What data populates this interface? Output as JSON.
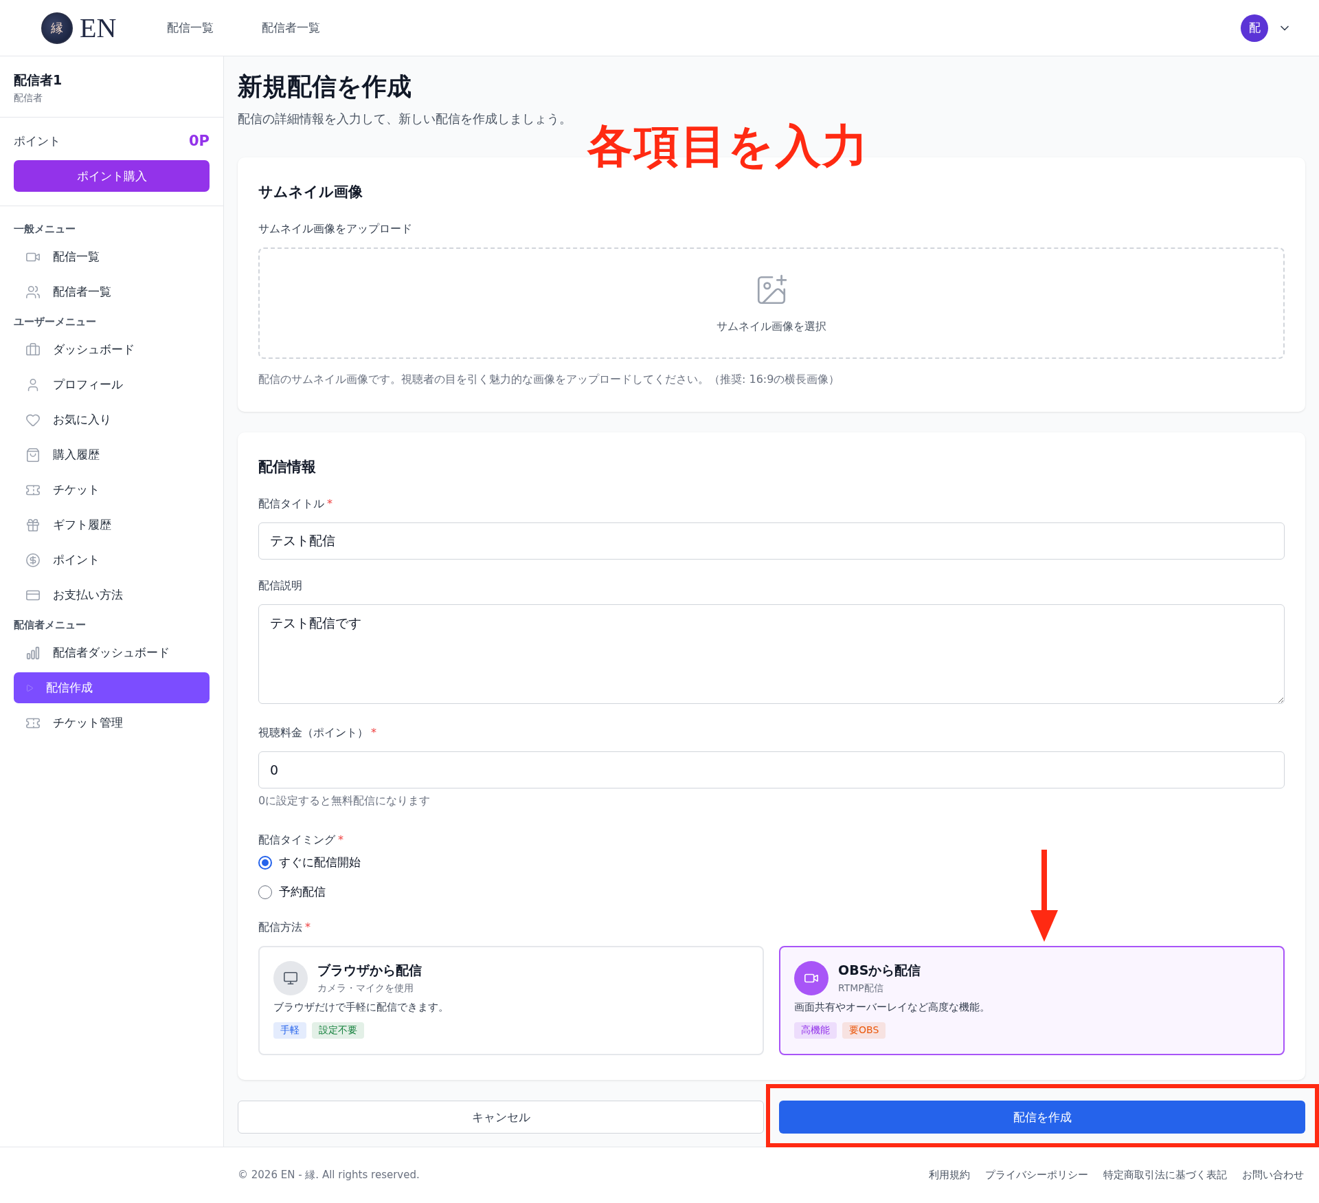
{
  "header": {
    "logo_mark": "縁",
    "logo_text": "EN",
    "nav": [
      "配信一覧",
      "配信者一覧"
    ],
    "avatar": "配"
  },
  "sidebar": {
    "user_name": "配信者1",
    "user_role": "配信者",
    "points_label": "ポイント",
    "points_value": "0P",
    "buy_button": "ポイント購入",
    "sections": [
      {
        "title": "一般メニュー",
        "items": [
          {
            "label": "配信一覧",
            "selected": false
          },
          {
            "label": "配信者一覧",
            "selected": false
          }
        ]
      },
      {
        "title": "ユーザーメニュー",
        "items": [
          {
            "label": "ダッシュボード",
            "selected": false
          },
          {
            "label": "プロフィール",
            "selected": false
          },
          {
            "label": "お気に入り",
            "selected": false
          },
          {
            "label": "購入履歴",
            "selected": false
          },
          {
            "label": "チケット",
            "selected": false
          },
          {
            "label": "ギフト履歴",
            "selected": false
          },
          {
            "label": "ポイント",
            "selected": false
          },
          {
            "label": "お支払い方法",
            "selected": false
          }
        ]
      },
      {
        "title": "配信者メニュー",
        "items": [
          {
            "label": "配信者ダッシュボード",
            "selected": false
          },
          {
            "label": "配信作成",
            "selected": true
          },
          {
            "label": "チケット管理",
            "selected": false
          }
        ]
      }
    ]
  },
  "page": {
    "title": "新規配信を作成",
    "subtitle": "配信の詳細情報を入力して、新しい配信を作成しましょう。"
  },
  "thumbnail_card": {
    "title": "サムネイル画像",
    "label": "サムネイル画像をアップロード",
    "drop_text": "サムネイル画像を選択",
    "help": "配信のサムネイル画像です。視聴者の目を引く魅力的な画像をアップロードしてください。（推奨: 16:9の横長画像）"
  },
  "info_card": {
    "title": "配信情報",
    "title_field": {
      "label": "配信タイトル",
      "required_mark": "*",
      "value": "テスト配信"
    },
    "description_field": {
      "label": "配信説明",
      "value": "テスト配信です"
    },
    "price_field": {
      "label": "視聴料金（ポイント）",
      "required_mark": "*",
      "value": "0",
      "help": "0に設定すると無料配信になります"
    },
    "timing": {
      "label": "配信タイミング",
      "required_mark": "*",
      "options": [
        {
          "label": "すぐに配信開始",
          "selected": true
        },
        {
          "label": "予約配信",
          "selected": false
        }
      ]
    },
    "method": {
      "label": "配信方法",
      "required_mark": "*",
      "options": [
        {
          "title": "ブラウザから配信",
          "subtitle": "カメラ・マイクを使用",
          "description": "ブラウザだけで手軽に配信できます。",
          "selected": false,
          "tags": [
            {
              "label": "手軽",
              "color": "#2563eb"
            },
            {
              "label": "設定不要",
              "color": "#15803d"
            }
          ]
        },
        {
          "title": "OBSから配信",
          "subtitle": "RTMP配信",
          "description": "画面共有やオーバーレイなど高度な機能。",
          "selected": true,
          "tags": [
            {
              "label": "高機能",
              "color": "#9333ea"
            },
            {
              "label": "要OBS",
              "color": "#ea580c"
            }
          ]
        }
      ]
    }
  },
  "actions": {
    "cancel": "キャンセル",
    "submit": "配信を作成"
  },
  "footer": {
    "copyright": "© 2026 EN - 縁. All rights reserved.",
    "links": [
      "利用規約",
      "プライバシーポリシー",
      "特定商取引法に基づく表記",
      "お問い合わせ"
    ]
  },
  "annotations": {
    "caption": "各項目を入力"
  }
}
